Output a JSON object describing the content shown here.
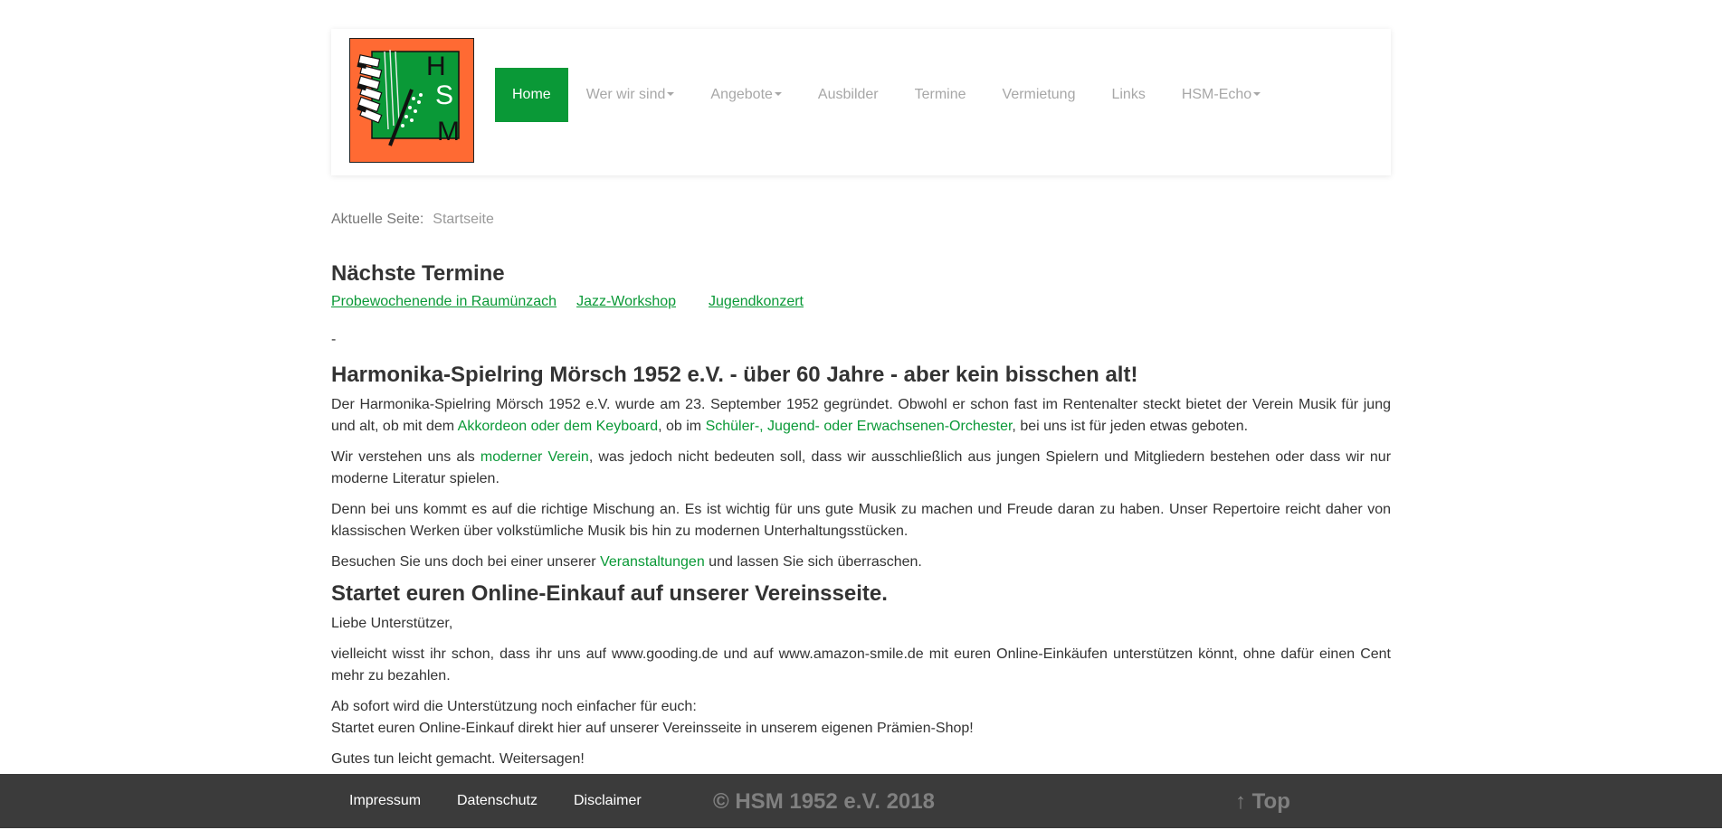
{
  "nav": {
    "logo_letters": [
      "H",
      "S",
      "M"
    ],
    "items": [
      {
        "label": "Home",
        "active": true
      },
      {
        "label": "Wer wir sind",
        "dropdown": true
      },
      {
        "label": "Angebote",
        "dropdown": true
      },
      {
        "label": "Ausbilder"
      },
      {
        "label": "Termine"
      },
      {
        "label": "Vermietung"
      },
      {
        "label": "Links"
      },
      {
        "label": "HSM-Echo",
        "dropdown": true
      }
    ]
  },
  "breadcrumb": {
    "label": "Aktuelle Seite:",
    "current": "Startseite"
  },
  "termine": {
    "heading": "Nächste Termine",
    "links": [
      "Probewochenende in Raumünzach",
      "Jazz-Workshop",
      "Jugendkonzert"
    ],
    "dash": "-"
  },
  "about": {
    "heading": "Harmonika-Spielring Mörsch 1952 e.V. - über 60 Jahre - aber kein bisschen alt!",
    "p1_a": "Der Harmonika-Spielring Mörsch 1952 e.V. wurde am 23. September 1952 gegründet. Obwohl er schon fast im Rentenalter steckt bietet der Verein Musik für jung und alt, ob mit dem ",
    "p1_link1": "Akkordeon oder dem Keyboard",
    "p1_b": ", ob im ",
    "p1_link2": "Schüler-, Jugend- oder Erwachsenen-Orchester",
    "p1_c": ", bei uns ist für jeden etwas geboten.",
    "p2_a": "Wir verstehen uns als ",
    "p2_link": "moderner Verein",
    "p2_b": ", was jedoch nicht bedeuten soll, dass wir ausschließlich aus jungen Spielern und Mitgliedern bestehen oder dass wir nur moderne Literatur spielen.",
    "p3": "Denn bei uns kommt es auf die richtige Mischung an. Es ist wichtig für uns gute Musik zu machen und Freude daran zu haben. Unser Repertoire reicht daher von klassischen Werken über volkstümliche Musik bis hin zu modernen Unterhaltungsstücken.",
    "p4_a": "Besuchen Sie uns doch bei einer unserer ",
    "p4_link": "Veranstaltungen",
    "p4_b": " und lassen Sie sich überraschen."
  },
  "shop": {
    "heading": "Startet euren Online-Einkauf auf unserer Vereinsseite.",
    "p1": "Liebe Unterstützer,",
    "p2": "vielleicht wisst ihr schon, dass ihr uns auf www.gooding.de und auf www.amazon-smile.de mit euren Online-Einkäufen unterstützen könnt, ohne dafür einen Cent mehr zu bezahlen.",
    "p3_line1": "Ab sofort wird die Unterstützung noch einfacher für euch:",
    "p3_line2": "Startet euren Online-Einkauf direkt hier auf unserer Vereinsseite in unserem eigenen Prämien-Shop!",
    "p4": "Gutes tun leicht gemacht. Weitersagen!"
  },
  "footer": {
    "links": [
      "Impressum",
      "Datenschutz",
      "Disclaimer"
    ],
    "copyright": "© HSM 1952 e.V. 2018",
    "top": "↑ Top"
  },
  "colors": {
    "accent": "#0a9937",
    "logo_orange": "#ff6a33",
    "footer_bg": "#3b3b3b"
  }
}
